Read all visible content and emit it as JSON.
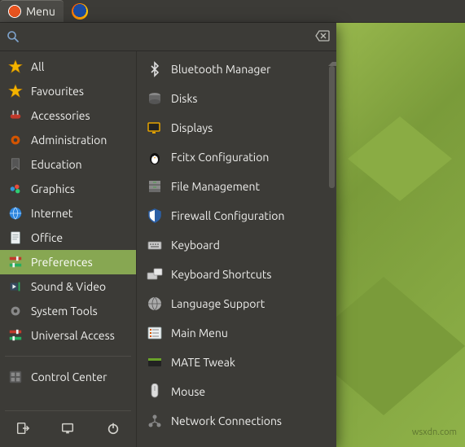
{
  "panel": {
    "menu_label": "Menu"
  },
  "search": {
    "placeholder": "",
    "value": ""
  },
  "categories": [
    {
      "id": "all",
      "label": "All",
      "icon": "star-gold",
      "selected": false
    },
    {
      "id": "favourites",
      "label": "Favourites",
      "icon": "star-gold",
      "selected": false
    },
    {
      "id": "accessories",
      "label": "Accessories",
      "icon": "swiss-knife",
      "selected": false
    },
    {
      "id": "administration",
      "label": "Administration",
      "icon": "gear-red",
      "selected": false
    },
    {
      "id": "education",
      "label": "Education",
      "icon": "bookmark",
      "selected": false
    },
    {
      "id": "graphics",
      "label": "Graphics",
      "icon": "palette",
      "selected": false
    },
    {
      "id": "internet",
      "label": "Internet",
      "icon": "globe",
      "selected": false
    },
    {
      "id": "office",
      "label": "Office",
      "icon": "document",
      "selected": false
    },
    {
      "id": "preferences",
      "label": "Preferences",
      "icon": "toggles",
      "selected": true
    },
    {
      "id": "sound-video",
      "label": "Sound & Video",
      "icon": "media",
      "selected": false
    },
    {
      "id": "system-tools",
      "label": "System Tools",
      "icon": "gear-gray",
      "selected": false
    },
    {
      "id": "universal",
      "label": "Universal Access",
      "icon": "toggles",
      "selected": false
    }
  ],
  "control_center": {
    "label": "Control Center"
  },
  "apps": [
    {
      "id": "bluetooth",
      "label": "Bluetooth Manager",
      "icon": "bluetooth"
    },
    {
      "id": "disks",
      "label": "Disks",
      "icon": "disks"
    },
    {
      "id": "displays",
      "label": "Displays",
      "icon": "displays"
    },
    {
      "id": "fcitx",
      "label": "Fcitx Configuration",
      "icon": "penguin"
    },
    {
      "id": "filemgmt",
      "label": "File Management",
      "icon": "filecab"
    },
    {
      "id": "firewall",
      "label": "Firewall Configuration",
      "icon": "shield"
    },
    {
      "id": "keyboard",
      "label": "Keyboard",
      "icon": "keyboard"
    },
    {
      "id": "kbshort",
      "label": "Keyboard Shortcuts",
      "icon": "kb-shortcut"
    },
    {
      "id": "language",
      "label": "Language Support",
      "icon": "globe-gray"
    },
    {
      "id": "mainmenu",
      "label": "Main Menu",
      "icon": "list"
    },
    {
      "id": "matetweak",
      "label": "MATE Tweak",
      "icon": "panel-green"
    },
    {
      "id": "mouse",
      "label": "Mouse",
      "icon": "mouse"
    },
    {
      "id": "network",
      "label": "Network Connections",
      "icon": "network"
    }
  ],
  "watermark": "wsxdn.com"
}
